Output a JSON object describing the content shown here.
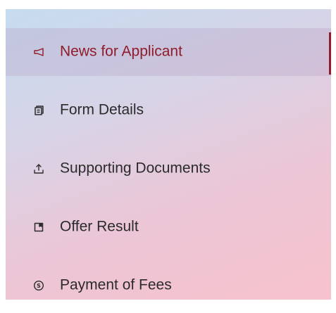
{
  "colors": {
    "active_accent": "#8f1b2b",
    "text": "#2b2b2b"
  },
  "nav": {
    "items": [
      {
        "label": "News for Applicant",
        "icon": "megaphone-icon",
        "active": true
      },
      {
        "label": "Form Details",
        "icon": "clipboard-icon",
        "active": false
      },
      {
        "label": "Supporting Documents",
        "icon": "upload-icon",
        "active": false
      },
      {
        "label": "Offer Result",
        "icon": "bookmark-icon",
        "active": false
      },
      {
        "label": "Payment of Fees",
        "icon": "dollar-circle-icon",
        "active": false
      }
    ]
  }
}
